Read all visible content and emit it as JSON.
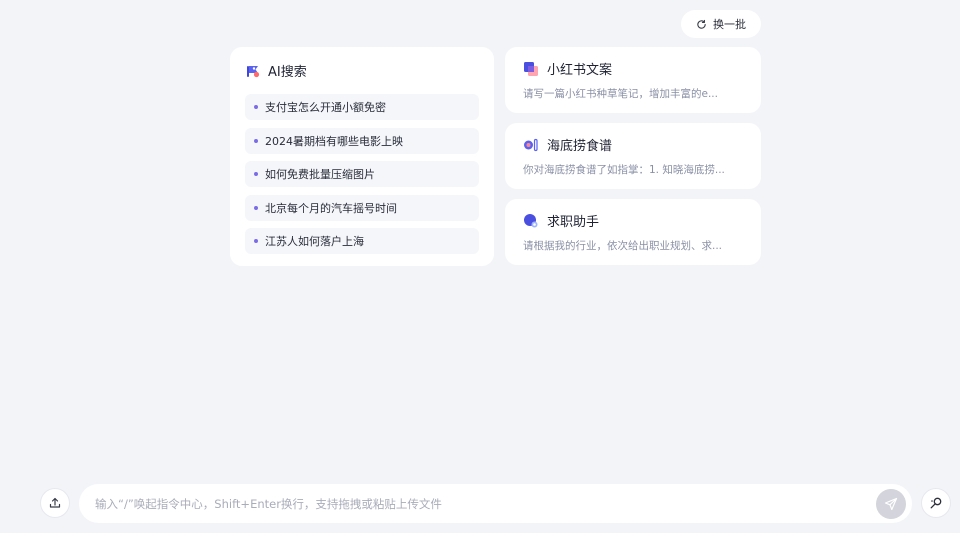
{
  "refresh": {
    "label": "换一批",
    "icon": "refresh-icon"
  },
  "ai_search": {
    "title": "AI搜索",
    "icon": "ai-search-icon",
    "items": [
      {
        "label": "支付宝怎么开通小额免密"
      },
      {
        "label": "2024暑期档有哪些电影上映"
      },
      {
        "label": "如何免费批量压缩图片"
      },
      {
        "label": "北京每个月的汽车摇号时间"
      },
      {
        "label": "江苏人如何落户上海"
      }
    ]
  },
  "agents": [
    {
      "title": "小红书文案",
      "desc": "请写一篇小红书种草笔记，增加丰富的e...",
      "icon": "xiaohongshu-icon"
    },
    {
      "title": "海底捞食谱",
      "desc": "你对海底捞食谱了如指掌：1. 知晓海底捞...",
      "icon": "recipe-icon"
    },
    {
      "title": "求职助手",
      "desc": "请根据我的行业，依次给出职业规划、求...",
      "icon": "job-assistant-icon"
    }
  ],
  "chat": {
    "placeholder": "输入“/”唤起指令中心，Shift+Enter换行，支持拖拽或粘贴上传文件",
    "value": ""
  },
  "colors": {
    "background": "#f3f4f8",
    "card": "#ffffff",
    "accent": "#7b6ce6",
    "send_disabled": "#d3d4dc"
  }
}
